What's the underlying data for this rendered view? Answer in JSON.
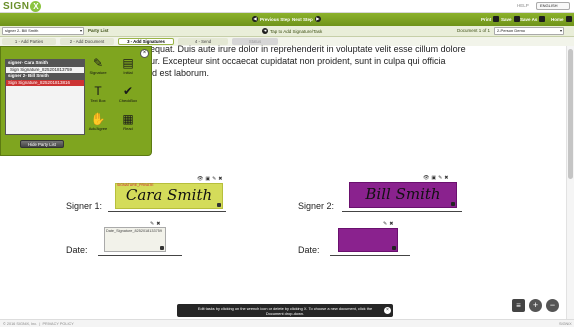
{
  "app": {
    "logo_text": "SIGN",
    "logo_badge": "X",
    "help": "HELP",
    "language": "ENGLISH"
  },
  "toolbar": {
    "prev_step": "Previous Step",
    "next_step": "Next Step",
    "print": "Print",
    "save": "Save",
    "save_as": "Save As",
    "home": "Home"
  },
  "subbar": {
    "signer_select": "signer 2- Bill Smith",
    "party_list": "Party List",
    "tap_add": "Tap to Add Signature/Task",
    "document_of": "Document 1 of 1",
    "document_select": "2-Person Demo"
  },
  "steps": [
    {
      "label": "1 - Add Parties"
    },
    {
      "label": "2 - Add Document"
    },
    {
      "label": "3 - Add Signatures"
    },
    {
      "label": "4 - Send"
    },
    {
      "label": "Status"
    }
  ],
  "document": {
    "line1": "equat. Duis aute irure dolor in reprehenderit in voluptate velit esse cillum dolore",
    "line2": "ur. Excepteur sint occaecat cupidatat non proident, sunt in culpa qui officia",
    "line3": "id est laborum.",
    "signer1_label": "Signer 1:",
    "signer2_label": "Signer 2:",
    "date1_label": "Date:",
    "date2_label": "Date:",
    "signer1_sig": "Cara Smith",
    "signer2_sig": "Bill Smith",
    "signer1_tag": "SIGNATURE_PRIVATE",
    "date1_value": "Date_Signature_8252018133759"
  },
  "party_panel": {
    "items": [
      {
        "label": "signer- Cara Smith",
        "kind": "header"
      },
      {
        "label": "Sign Signature_825201813759",
        "kind": "sub"
      },
      {
        "label": "signer 2- Bill Smith",
        "kind": "header"
      },
      {
        "label": "Sign Signature_825201813816",
        "kind": "selected"
      }
    ],
    "hide_button": "Hide Party List",
    "tools": [
      {
        "label": "Signature",
        "glyph": "✎"
      },
      {
        "label": "Initial",
        "glyph": "▤"
      },
      {
        "label": "Text Box",
        "glyph": "T"
      },
      {
        "label": "CheckBox",
        "glyph": "✔"
      },
      {
        "label": "Ack/Agree",
        "glyph": "✋"
      },
      {
        "label": "Read",
        "glyph": "▦"
      }
    ]
  },
  "tooltip": {
    "text": "Edit tasks by clicking on the wrench icon or delete by clicking X. To choose a new document, click the Document drop-down."
  },
  "footer": {
    "copyright": "© 2016 SIGNiX, Inc.",
    "privacy": "PRIVACY POLICY",
    "brand": "SIGNiX"
  },
  "colors": {
    "brand_green": "#7da21f",
    "signer1_field": "#d4dc5a",
    "signer2_field": "#8a228e",
    "selected_party": "#cc3333"
  }
}
